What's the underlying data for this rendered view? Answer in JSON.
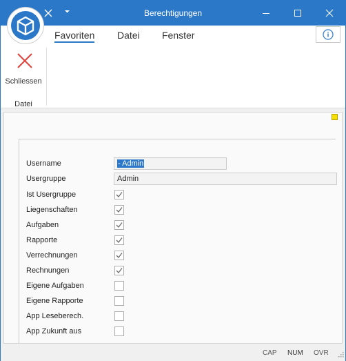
{
  "window": {
    "title": "Berechtigungen"
  },
  "icons": {
    "logo": "app-logo-cube-icon",
    "qa_close": "close-icon",
    "qa_dropdown": "chevron-down-icon",
    "minimize": "minimize-icon",
    "maximize": "maximize-icon",
    "close": "close-icon",
    "help": "info-icon",
    "close_command": "close-x-icon",
    "check": "check-icon",
    "grip": "resize-grip-icon"
  },
  "colors": {
    "accent": "#2b78c9",
    "close_red": "#e0413a",
    "marker": "#f7e000"
  },
  "tabs": [
    {
      "label": "Favoriten",
      "active": true
    },
    {
      "label": "Datei",
      "active": false
    },
    {
      "label": "Fenster",
      "active": false
    }
  ],
  "ribbon": {
    "close_label": "Schliessen",
    "group_label": "Datei"
  },
  "form": {
    "username_label": "Username",
    "username_value": "- Admin",
    "usergroup_label": "Usergruppe",
    "usergroup_value": "Admin",
    "checkboxes": [
      {
        "label": "Ist Usergruppe",
        "checked": true
      },
      {
        "label": "Liegenschaften",
        "checked": true
      },
      {
        "label": "Aufgaben",
        "checked": true
      },
      {
        "label": "Rapporte",
        "checked": true
      },
      {
        "label": "Verrechnungen",
        "checked": true
      },
      {
        "label": "Rechnungen",
        "checked": true
      },
      {
        "label": "Eigene Aufgaben",
        "checked": false
      },
      {
        "label": "Eigene Rapporte",
        "checked": false
      },
      {
        "label": "App Leseberech.",
        "checked": false
      },
      {
        "label": "App Zukunft aus",
        "checked": false
      }
    ]
  },
  "status": {
    "cap": "CAP",
    "num": "NUM",
    "ovr": "OVR"
  }
}
